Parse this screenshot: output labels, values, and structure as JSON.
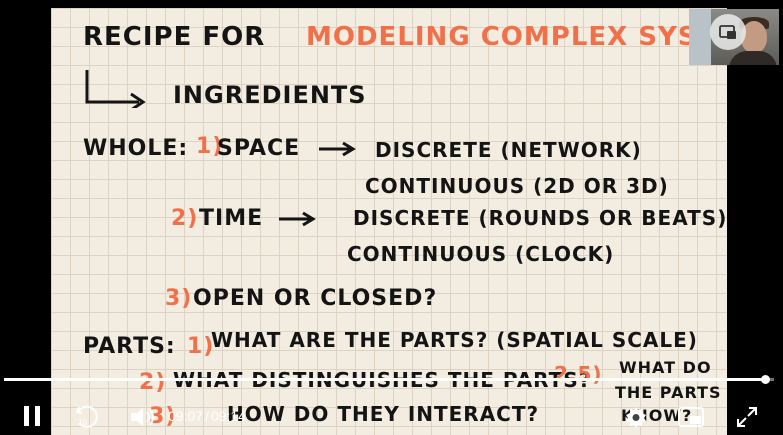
{
  "slide": {
    "title_black": "RECIPE FOR",
    "title_red": "MODELING COMPLEX SYSTEMS",
    "subheading": "INGREDIENTS",
    "whole_label": "WHOLE:",
    "item1_num": "1)",
    "item1_text": "SPACE",
    "item1_discrete": "DISCRETE (NETWORK)",
    "item1_continuous": "CONTINUOUS (2D OR 3D)",
    "item2_num": "2)",
    "item2_text": "TIME",
    "item2_discrete": "DISCRETE (ROUNDS OR BEATS)",
    "item2_continuous": "CONTINUOUS (CLOCK)",
    "item3_num": "3)",
    "item3_text": "OPEN OR CLOSED?",
    "parts_label": "PARTS:",
    "parts1_num": "1)",
    "parts1_text": "WHAT ARE THE PARTS? (SPATIAL SCALE)",
    "parts2_num": "2)",
    "parts2_text": "WHAT DISTINGUISHES THE PARTS?",
    "parts25_num": "2.5)",
    "parts25_text_l1": "WHAT DO",
    "parts25_text_l2": "THE PARTS",
    "parts25_text_l3": "KNOW?",
    "parts3_num": "3)",
    "parts3_text": "HOW DO THEY INTERACT?"
  },
  "player": {
    "current_time": "09:07",
    "separator": "/",
    "duration": "09:14",
    "progress": 0.988,
    "replay_seconds": "10"
  },
  "icons": {
    "play_pause": "pause-icon",
    "replay": "replay-10-icon",
    "volume": "volume-icon",
    "settings": "gear-icon",
    "pip": "picture-in-picture-icon",
    "fullscreen": "fullscreen-icon"
  }
}
